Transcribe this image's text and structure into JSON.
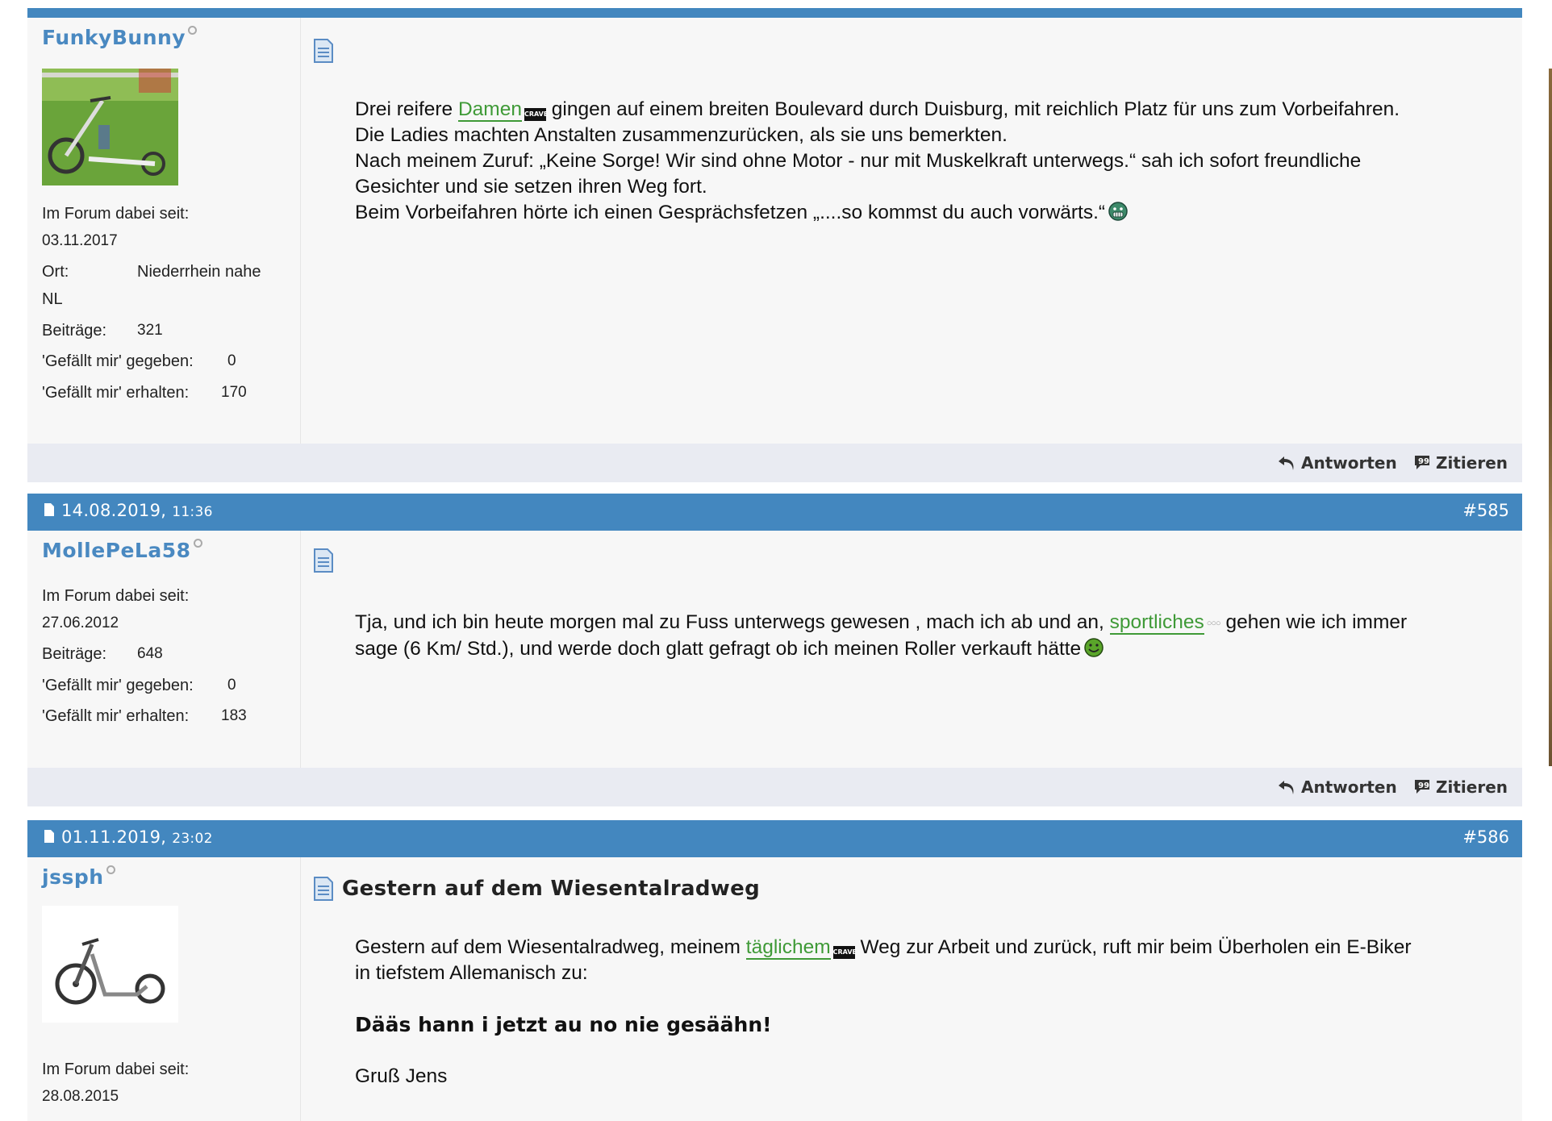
{
  "posts": [
    {
      "author": "FunkyBunny",
      "stats": {
        "joined_label": "Im Forum dabei seit:",
        "joined_value": "03.11.2017",
        "location_label": "Ort:",
        "location_value": "Niederrhein nahe",
        "location_value2": "NL",
        "posts_label": "Beiträge:",
        "posts_value": "321",
        "likes_given_label": "'Gefällt mir' gegeben:",
        "likes_given_value": "0",
        "likes_received_label": "'Gefällt mir' erhalten:",
        "likes_received_value": "170"
      },
      "body": {
        "l1_pre": "Drei reifere ",
        "l1_link": "Damen",
        "l1_post": " gingen auf einem breiten Boulevard durch Duisburg, mit reichlich Platz für uns zum Vorbeifahren.",
        "l2": "Die Ladies machten Anstalten zusammenzurücken, als sie uns bemerkten.",
        "l3": "Nach meinem Zuruf: „Keine Sorge! Wir sind ohne Motor - nur mit Muskelkraft unterwegs.“ sah ich sofort freundliche",
        "l4": "Gesichter und sie setzen ihren Weg fort.",
        "l5": "Beim Vorbeifahren hörte ich einen Gesprächsfetzen „....so kommst du auch vorwärts.“"
      }
    },
    {
      "date": "14.08.2019,",
      "time": "11:36",
      "number": "#585",
      "author": "MollePeLa58",
      "stats": {
        "joined_label": "Im Forum dabei seit:",
        "joined_value": "27.06.2012",
        "posts_label": "Beiträge:",
        "posts_value": "648",
        "likes_given_label": "'Gefällt mir' gegeben:",
        "likes_given_value": "0",
        "likes_received_label": "'Gefällt mir' erhalten:",
        "likes_received_value": "183"
      },
      "body": {
        "l1_pre": "Tja, und ich bin heute morgen mal zu Fuss unterwegs gewesen , mach ich ab und an, ",
        "l1_link": "sportliches",
        "l1_post": " gehen wie ich immer",
        "l2": "sage (6 Km/ Std.), und werde doch glatt gefragt ob ich meinen Roller verkauft hätte"
      }
    },
    {
      "date": "01.11.2019,",
      "time": "23:02",
      "number": "#586",
      "author": "jssph",
      "title": "Gestern auf dem Wiesentalradweg",
      "stats": {
        "joined_label": "Im Forum dabei seit:",
        "joined_value": "28.08.2015"
      },
      "body": {
        "l1_pre": "Gestern auf dem Wiesentalradweg, meinem ",
        "l1_link": "täglichem",
        "l1_post": " Weg zur Arbeit und zurück, ruft mir beim Überholen ein E-Biker",
        "l2": "in tiefstem Allemanisch zu:",
        "bold": "Dääs hann i jetzt au no nie gesäähn!",
        "sign": "Gruß Jens"
      }
    }
  ],
  "actions": {
    "reply": "Antworten",
    "quote": "Zitieren"
  },
  "badge_text": "CRAVE"
}
